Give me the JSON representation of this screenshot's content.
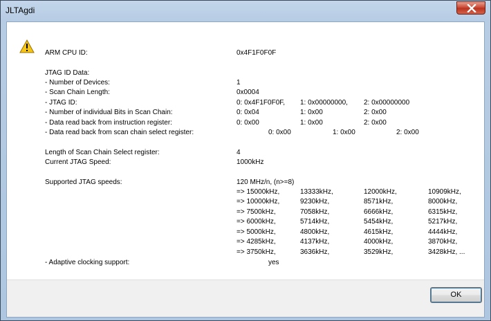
{
  "window": {
    "title": "JLTAgdi"
  },
  "cpu": {
    "label": "ARM CPU ID:",
    "value": "0x4F1F0F0F"
  },
  "jtag": {
    "section_label": "JTAG ID Data:",
    "num_devices": {
      "label": "-  Number of Devices:",
      "value": "1"
    },
    "scan_chain_length": {
      "label": "-  Scan Chain Length:",
      "value": "0x0004"
    },
    "jtag_id": {
      "label": "-  JTAG ID:",
      "values": [
        "0: 0x4F1F0F0F,",
        "1: 0x00000000,",
        "2: 0x00000000"
      ]
    },
    "bits_in_chain": {
      "label": "-  Number of individual Bits in Scan Chain:",
      "values": [
        "0: 0x04",
        "1: 0x00",
        "2: 0x00"
      ]
    },
    "instr_register": {
      "label": "-  Data read back from instruction register:",
      "values": [
        "0: 0x00",
        "1: 0x00",
        "2: 0x00"
      ]
    },
    "select_register": {
      "label": "-  Data read back from scan chain select register:",
      "values": [
        "0: 0x00",
        "1: 0x00",
        "2: 0x00"
      ]
    }
  },
  "select_reg_length": {
    "label": "Length of Scan Chain Select register:",
    "value": "4"
  },
  "current_speed": {
    "label": "Current JTAG Speed:",
    "value": "1000kHz"
  },
  "speeds": {
    "label": "Supported JTAG speeds:",
    "header": "120 MHz/n, (n>=8)",
    "rows": [
      [
        "=> 15000kHz,",
        "13333kHz,",
        "12000kHz,",
        "10909kHz,"
      ],
      [
        "=> 10000kHz,",
        "9230kHz,",
        "8571kHz,",
        "8000kHz,"
      ],
      [
        "=> 7500kHz,",
        "7058kHz,",
        "6666kHz,",
        "6315kHz,"
      ],
      [
        "=> 6000kHz,",
        "5714kHz,",
        "5454kHz,",
        "5217kHz,"
      ],
      [
        "=> 5000kHz,",
        "4800kHz,",
        "4615kHz,",
        "4444kHz,"
      ],
      [
        "=> 4285kHz,",
        "4137kHz,",
        "4000kHz,",
        "3870kHz,"
      ],
      [
        "=> 3750kHz,",
        "3636kHz,",
        "3529kHz,",
        "3428kHz, ..."
      ]
    ]
  },
  "adaptive": {
    "label": "-  Adaptive clocking support:",
    "value": "yes"
  },
  "buttons": {
    "ok": "OK"
  },
  "icons": {
    "warning": "warning-icon",
    "close": "close-icon"
  }
}
